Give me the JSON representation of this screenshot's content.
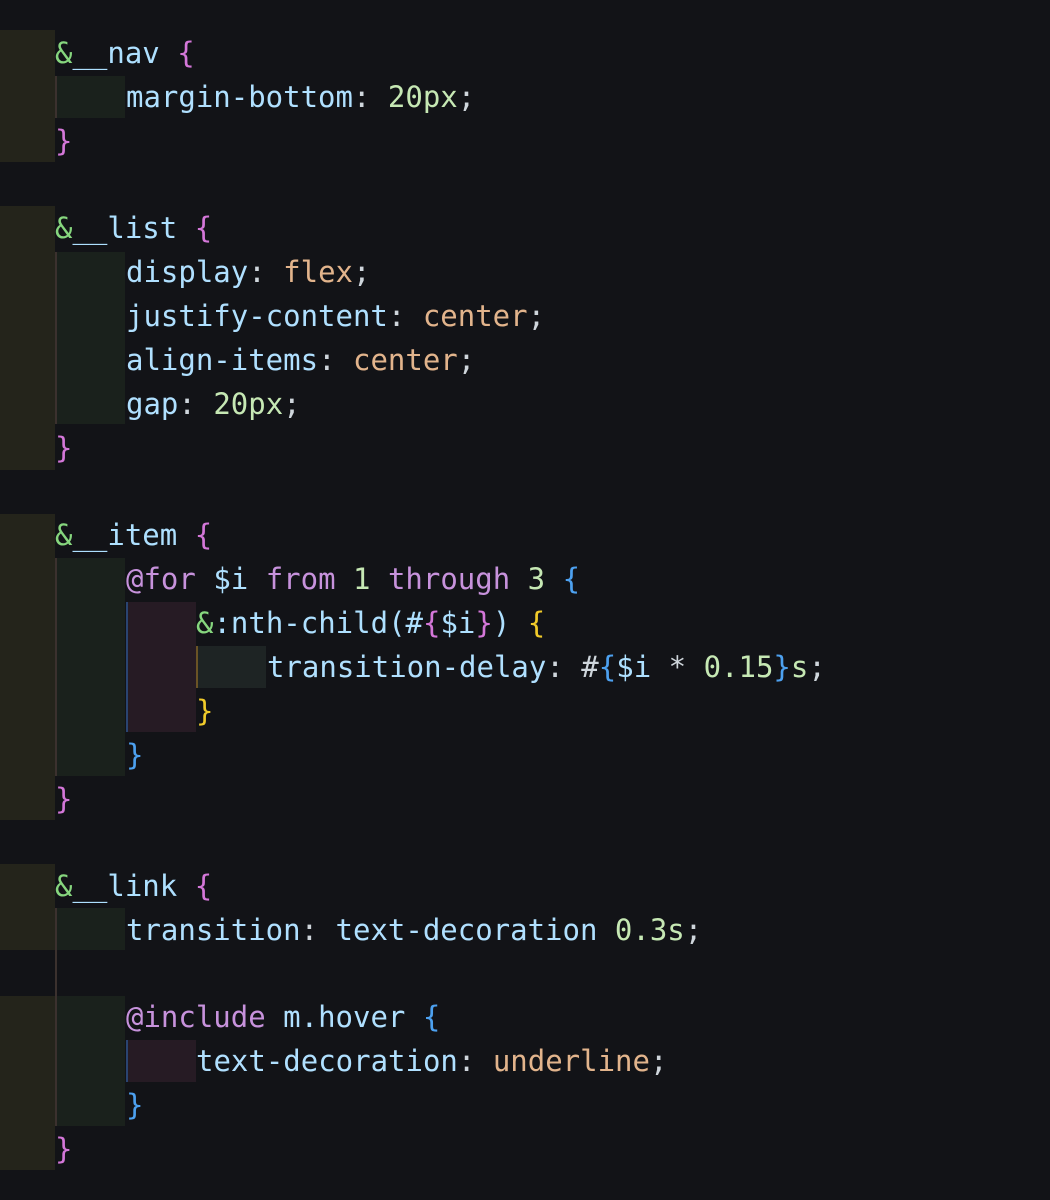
{
  "colors": {
    "background": "#121317",
    "ampersand": "#86d67e",
    "selector": "#aee0ff",
    "brace_level1": "#d477d9",
    "brace_level2": "#4da1f0",
    "brace_level3": "#f1cb2a",
    "property": "#b0e0ff",
    "number": "#c6e8b4",
    "keyword_value": "#e2b48c",
    "at_rule": "#c792dc"
  },
  "code": {
    "nav": {
      "amp": "&",
      "name": "__nav",
      "open": "{",
      "p1": "margin-bottom",
      "v1": "20px",
      "close": "}"
    },
    "list": {
      "amp": "&",
      "name": "__list",
      "open": "{",
      "p1": "display",
      "v1": "flex",
      "p2": "justify-content",
      "v2": "center",
      "p3": "align-items",
      "v3": "center",
      "p4": "gap",
      "v4": "20px",
      "close": "}"
    },
    "item": {
      "amp": "&",
      "name": "__item",
      "open": "{",
      "for_kw": "@for",
      "for_var": "$i",
      "from_kw": "from",
      "from_val": "1",
      "through_kw": "through",
      "through_val": "3",
      "for_open": "{",
      "nth_amp": "&",
      "nth_sel": ":nth-child(#",
      "nth_interp_open": "{",
      "nth_var": "$i",
      "nth_interp_close": "}",
      "nth_paren": ")",
      "nth_open": "{",
      "td_prop": "transition-delay",
      "td_hash": "#",
      "td_interp_open": "{",
      "td_var": "$i",
      "td_op": "*",
      "td_num": "0.15",
      "td_interp_close": "}",
      "td_unit": "s",
      "nth_close": "}",
      "for_close": "}",
      "close": "}"
    },
    "link": {
      "amp": "&",
      "name": "__link",
      "open": "{",
      "tr_prop": "transition",
      "tr_val": "text-decoration",
      "tr_num": "0.3s",
      "include_kw": "@include",
      "include_name": "m.hover",
      "include_open": "{",
      "td_prop": "text-decoration",
      "td_val": "underline",
      "include_close": "}",
      "close": "}"
    },
    "colon": ":",
    "semicolon": ";"
  }
}
